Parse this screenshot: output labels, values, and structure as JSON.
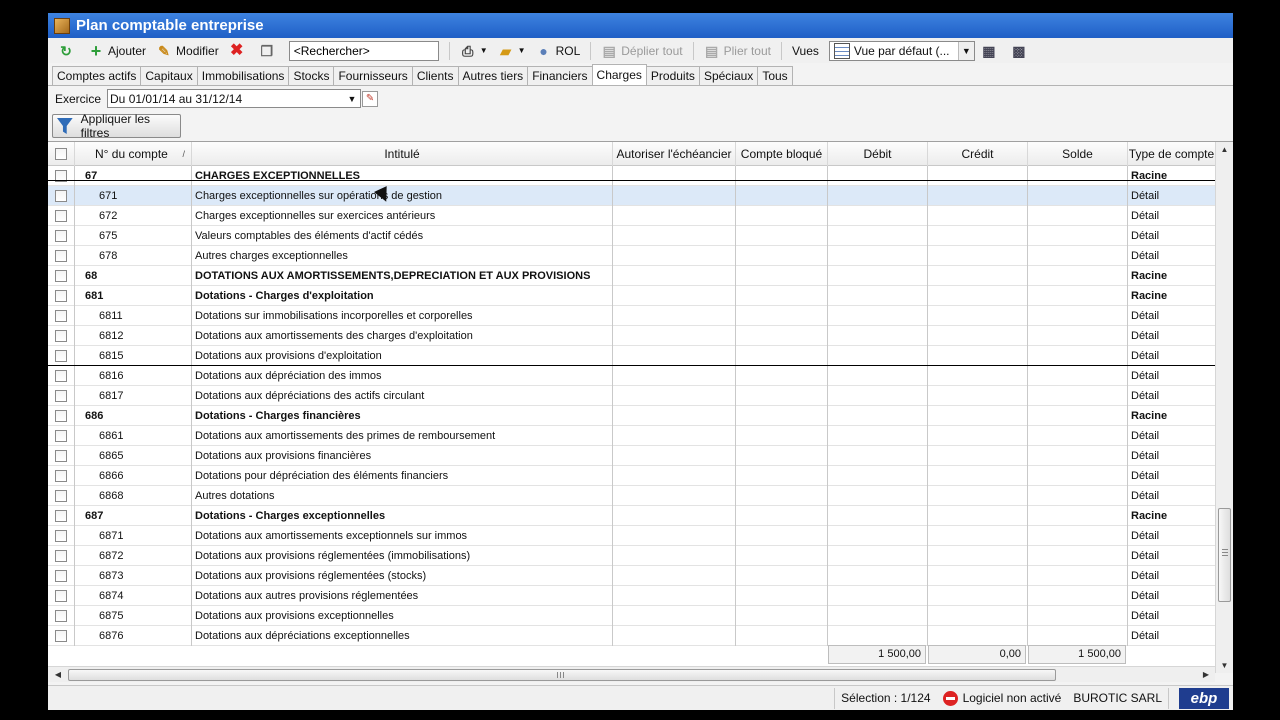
{
  "window": {
    "title": "Plan comptable entreprise"
  },
  "toolbar": {
    "add_label": "Ajouter",
    "edit_label": "Modifier",
    "search_placeholder": "<Rechercher>",
    "rol_label": "ROL",
    "expand_all_label": "Déplier tout",
    "collapse_all_label": "Plier tout",
    "views_label": "Vues",
    "view_selected": "Vue par défaut (..."
  },
  "tabs": [
    "Comptes actifs",
    "Capitaux",
    "Immobilisations",
    "Stocks",
    "Fournisseurs",
    "Clients",
    "Autres tiers",
    "Financiers",
    "Charges",
    "Produits",
    "Spéciaux",
    "Tous"
  ],
  "active_tab": "Charges",
  "filter": {
    "exercice_label": "Exercice",
    "exercice_value": "Du 01/01/14 au 31/12/14",
    "apply_label": "Appliquer les filtres"
  },
  "grid": {
    "columns": [
      "N° du compte",
      "Intitulé",
      "Autoriser l'échéancier",
      "Compte bloqué",
      "Débit",
      "Crédit",
      "Solde",
      "Type de compte"
    ],
    "rows": [
      {
        "num": "67",
        "label": "CHARGES EXCEPTIONNELLES",
        "type": "Racine"
      },
      {
        "num": "671",
        "label": "Charges exceptionnelles sur opérations de gestion",
        "type": "Détail"
      },
      {
        "num": "672",
        "label": "Charges exceptionnelles sur exercices antérieurs",
        "type": "Détail"
      },
      {
        "num": "675",
        "label": "Valeurs comptables des éléments d'actif cédés",
        "type": "Détail"
      },
      {
        "num": "678",
        "label": "Autres charges exceptionnelles",
        "type": "Détail"
      },
      {
        "num": "68",
        "label": "DOTATIONS AUX AMORTISSEMENTS,DEPRECIATION ET AUX PROVISIONS",
        "type": "Racine"
      },
      {
        "num": "681",
        "label": "Dotations - Charges d'exploitation",
        "type": "Racine"
      },
      {
        "num": "6811",
        "label": "Dotations sur immobilisations incorporelles et corporelles",
        "type": "Détail"
      },
      {
        "num": "6812",
        "label": "Dotations aux amortissements des charges d'exploitation",
        "type": "Détail"
      },
      {
        "num": "6815",
        "label": "Dotations aux provisions d'exploitation",
        "type": "Détail"
      },
      {
        "num": "6816",
        "label": "Dotations aux dépréciation des immos",
        "type": "Détail"
      },
      {
        "num": "6817",
        "label": "Dotations aux dépréciations des actifs circulant",
        "type": "Détail"
      },
      {
        "num": "686",
        "label": "Dotations - Charges financières",
        "type": "Racine"
      },
      {
        "num": "6861",
        "label": "Dotations aux amortissements des primes de remboursement",
        "type": "Détail"
      },
      {
        "num": "6865",
        "label": "Dotations aux provisions financières",
        "type": "Détail"
      },
      {
        "num": "6866",
        "label": "Dotations pour dépréciation des éléments financiers",
        "type": "Détail"
      },
      {
        "num": "6868",
        "label": "Autres dotations",
        "type": "Détail"
      },
      {
        "num": "687",
        "label": "Dotations  - Charges exceptionnelles",
        "type": "Racine"
      },
      {
        "num": "6871",
        "label": "Dotations aux amortissements exceptionnels sur immos",
        "type": "Détail"
      },
      {
        "num": "6872",
        "label": "Dotations aux provisions réglementées (immobilisations)",
        "type": "Détail"
      },
      {
        "num": "6873",
        "label": "Dotations aux provisions réglementées (stocks)",
        "type": "Détail"
      },
      {
        "num": "6874",
        "label": "Dotations aux autres provisions réglementées",
        "type": "Détail"
      },
      {
        "num": "6875",
        "label": "Dotations aux provisions exceptionnelles",
        "type": "Détail"
      },
      {
        "num": "6876",
        "label": "Dotations aux dépréciations exceptionnelles",
        "type": "Détail"
      }
    ],
    "totals": {
      "debit": "1 500,00",
      "credit": "0,00",
      "solde": "1 500,00"
    }
  },
  "status": {
    "selection": "Sélection : 1/124",
    "license": "Logiciel non activé",
    "company": "BUROTIC SARL",
    "brand": "ebp"
  },
  "colors": {
    "title_bar": "#2a6fd6",
    "selected_row": "#dce9f8",
    "accent_green": "#2e9e3a",
    "delete_red": "#d22222"
  },
  "icons": [
    "refresh-icon",
    "add-icon",
    "edit-icon",
    "delete-icon",
    "copy-icon",
    "print-icon",
    "export-icon",
    "user-icon",
    "expand-icon",
    "collapse-icon",
    "grid-view-icon",
    "column-settings-icon",
    "filter-icon",
    "stop-icon"
  ]
}
